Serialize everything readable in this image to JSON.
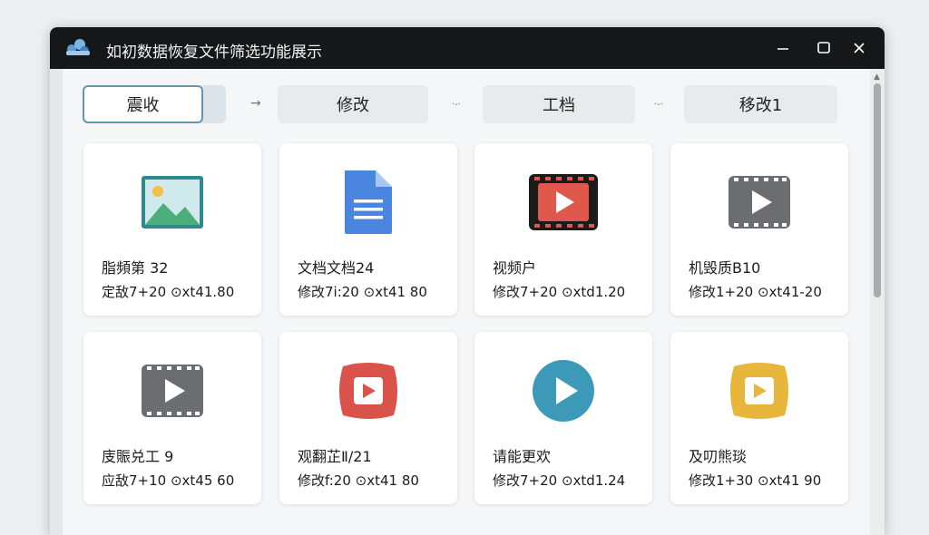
{
  "window": {
    "title": "如初数据恢复文件筛选功能展示"
  },
  "tabs": [
    {
      "label": "震收",
      "active": true
    },
    {
      "label": "修改",
      "active": false
    },
    {
      "label": "工档",
      "active": false
    },
    {
      "label": "移改1",
      "active": false
    }
  ],
  "separators": [
    "→",
    "·-·",
    "·-·"
  ],
  "cards": [
    {
      "icon": "image-file-icon",
      "name": "脂頻第 32",
      "meta": "定敌7+20 ⊙xt41.80"
    },
    {
      "icon": "document-file-icon",
      "name": "文档文档24",
      "meta": "修改7i:20 ⊙xt41 80"
    },
    {
      "icon": "video-file-red-icon",
      "name": "视频户",
      "meta": "修改7+20 ⊙xtd1.20"
    },
    {
      "icon": "video-file-gray-icon",
      "name": "机毁质B10",
      "meta": "修改1+20 ⊙xt41-20"
    },
    {
      "icon": "video-file-gray-icon",
      "name": "庋賑兑工 9",
      "meta": "应敌7+10 ⊙xt45 60"
    },
    {
      "icon": "video-badge-red-icon",
      "name": "观翻芷Ⅱ/21",
      "meta": "修改f:20 ⊙xt41 80"
    },
    {
      "icon": "play-circle-icon",
      "name": "请能更欢",
      "meta": "修改7+20 ⊙xtd1.24"
    },
    {
      "icon": "video-badge-yellow-icon",
      "name": "及叨熊琰",
      "meta": "修改1+30 ⊙xt41 90"
    }
  ],
  "colors": {
    "titlebar": "#161718",
    "active_tab_border": "#5f97b5",
    "video_red": "#e0584b",
    "video_gray": "#6b6d70",
    "doc_blue": "#4a86e0",
    "play_teal": "#3c9ab8",
    "badge_yellow": "#e8b63b"
  }
}
